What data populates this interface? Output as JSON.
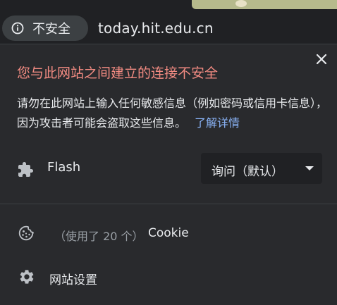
{
  "omnibox": {
    "security_chip_label": "不安全",
    "security_icon": "info-icon",
    "url": "today.hit.edu.cn"
  },
  "panel": {
    "title": "您与此网站之间建立的连接不安全",
    "description": "请勿在此网站上输入任何敏感信息（例如密码或信用卡信息），因为攻击者可能会盗取这些信息。",
    "learn_more_link": "了解详情",
    "close_icon": "close-icon",
    "permissions": [
      {
        "icon": "puzzle-icon",
        "label": "Flash",
        "selected": "询问（默认）"
      }
    ],
    "cookies": {
      "icon": "cookie-icon",
      "count_text": "（使用了 20 个）",
      "label": "Cookie"
    },
    "site_settings": {
      "icon": "gear-icon",
      "label": "网站设置"
    }
  },
  "colors": {
    "background": "#202124",
    "panel": "#292a2d",
    "warning": "#f28b82",
    "link": "#8ab4f8",
    "text": "#e8eaed",
    "muted": "#9aa0a6"
  }
}
